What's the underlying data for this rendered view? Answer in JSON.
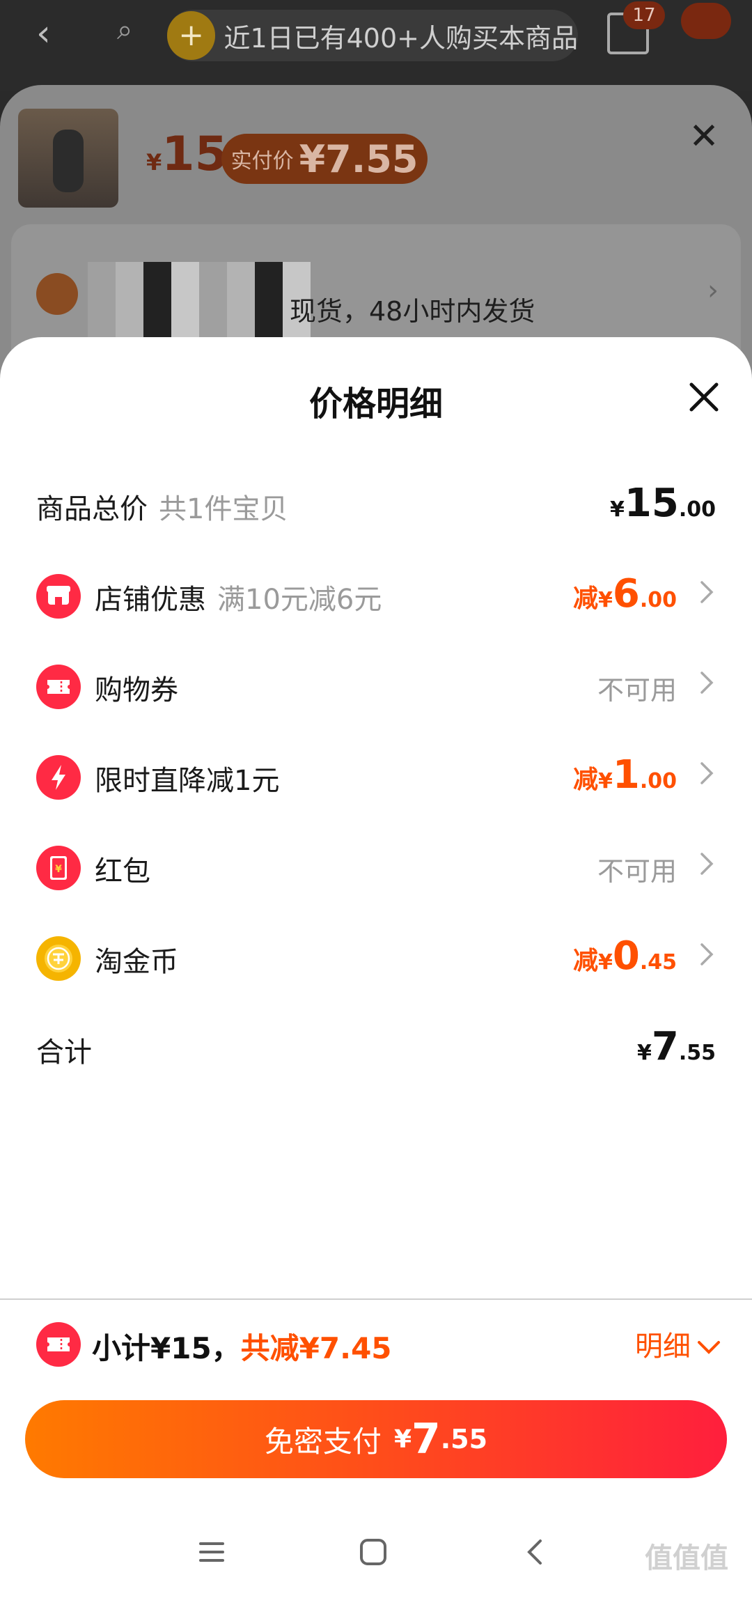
{
  "background_page": {
    "notice": "近1日已有400+人购买本商品",
    "cart_badge": "17",
    "price_yen": "¥",
    "price": "15",
    "pay_label": "实付价",
    "pay_value": "¥7.55",
    "shipping": "现货，48小时内发货"
  },
  "sheet": {
    "title": "价格明细",
    "rows": [
      {
        "label": "商品总价",
        "sub": "共1件宝贝",
        "prefix": "",
        "yen": "¥",
        "int": "15",
        "dec": ".00",
        "style": "dark"
      },
      {
        "label": "店铺优惠",
        "sub": "满10元减6元",
        "prefix": "减",
        "yen": "¥",
        "int": "6",
        "dec": ".00",
        "style": "red",
        "icon": "shop-icon"
      },
      {
        "label": "购物券",
        "sub": "",
        "status": "不可用",
        "icon": "coupon-icon"
      },
      {
        "label": "限时直降减1元",
        "sub": "",
        "prefix": "减",
        "yen": "¥",
        "int": "1",
        "dec": ".00",
        "style": "red",
        "icon": "lightning-icon"
      },
      {
        "label": "红包",
        "sub": "",
        "status": "不可用",
        "icon": "red-packet-icon"
      },
      {
        "label": "淘金币",
        "sub": "",
        "prefix": "减",
        "yen": "¥",
        "int": "0",
        "dec": ".45",
        "style": "red",
        "icon": "gold-coin-icon"
      },
      {
        "label": "合计",
        "sub": "",
        "prefix": "",
        "yen": "¥",
        "int": "7",
        "dec": ".55",
        "style": "dark"
      }
    ]
  },
  "summary": {
    "subtotal": "小计¥15，",
    "discount": "共减¥7.45",
    "detail_label": "明细"
  },
  "pay_button": {
    "label": "免密支付",
    "yen": "¥",
    "int": "7",
    "dec": ".55"
  },
  "watermark": "值值值",
  "colors": {
    "accent": "#ff5000",
    "coupon_red": "#ff2a44",
    "gold": "#f5b400",
    "gradient_start": "#ff7a00",
    "gradient_end": "#ff1f3d"
  }
}
